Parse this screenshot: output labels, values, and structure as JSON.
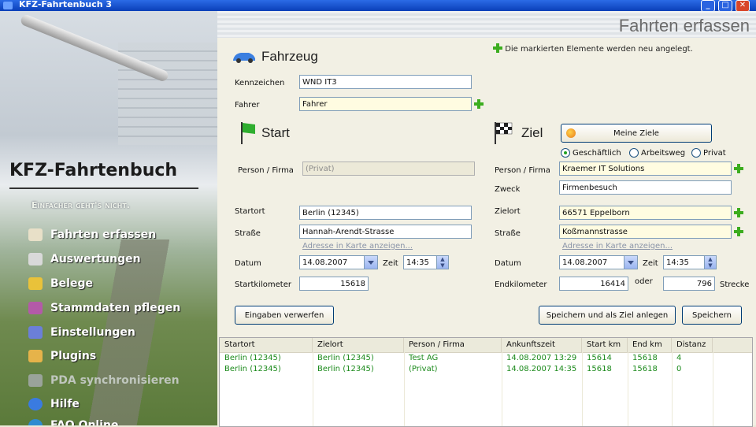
{
  "window": {
    "title": "KFZ-Fahrtenbuch 3"
  },
  "sidebar": {
    "brand": "KFZ-Fahrtenbuch",
    "slogan": "Einfacher geht's nicht.",
    "items": [
      {
        "label": "Fahrten erfassen",
        "icon": "edit-icon",
        "enabled": true
      },
      {
        "label": "Auswertungen",
        "icon": "printer-icon",
        "enabled": true
      },
      {
        "label": "Belege",
        "icon": "receipt-icon",
        "enabled": true
      },
      {
        "label": "Stammdaten pflegen",
        "icon": "database-icon",
        "enabled": true
      },
      {
        "label": "Einstellungen",
        "icon": "checklist-icon",
        "enabled": true
      },
      {
        "label": "Plugins",
        "icon": "plugin-icon",
        "enabled": true
      },
      {
        "label": "PDA synchronisieren",
        "icon": "pda-icon",
        "enabled": false
      },
      {
        "label": "Hilfe",
        "icon": "help-icon",
        "enabled": true
      },
      {
        "label": "FAQ Online",
        "icon": "globe-icon",
        "enabled": true
      }
    ]
  },
  "page": {
    "title": "Fahrten erfassen",
    "hint": "Die markierten Elemente werden neu angelegt."
  },
  "vehicle": {
    "title": "Fahrzeug",
    "plate_label": "Kennzeichen",
    "plate_value": "WND IT3",
    "driver_label": "Fahrer",
    "driver_value": "Fahrer"
  },
  "start": {
    "title": "Start",
    "person_label": "Person / Firma",
    "person_value": "(Privat)",
    "place_label": "Startort",
    "place_value": "Berlin (12345)",
    "street_label": "Straße",
    "street_value": "Hannah-Arendt-Strasse",
    "map_link": "Adresse in Karte anzeigen...",
    "date_label": "Datum",
    "date_value": "14.08.2007",
    "time_label": "Zeit",
    "time_value": "14:35",
    "km_label": "Startkilometer",
    "km_value": "15618"
  },
  "destination": {
    "title": "Ziel",
    "my_goals_button": "Meine Ziele",
    "purpose_options": [
      {
        "label": "Geschäftlich",
        "selected": true
      },
      {
        "label": "Arbeitsweg",
        "selected": false
      },
      {
        "label": "Privat",
        "selected": false
      }
    ],
    "person_label": "Person / Firma",
    "person_value": "Kraemer IT Solutions",
    "reason_label": "Zweck",
    "reason_value": "Firmenbesuch",
    "place_label": "Zielort",
    "place_value": "66571 Eppelborn",
    "street_label": "Straße",
    "street_value": "Koßmannstrasse",
    "map_link": "Adresse in Karte anzeigen...",
    "date_label": "Datum",
    "date_value": "14.08.2007",
    "time_label": "Zeit",
    "time_value": "14:35",
    "km_label": "Endkilometer",
    "km_value": "16414",
    "or_label": "oder",
    "distance_value": "796",
    "distance_label": "Strecke"
  },
  "actions": {
    "discard": "Eingaben verwerfen",
    "save_as_goal": "Speichern und als Ziel anlegen",
    "save": "Speichern"
  },
  "table": {
    "columns": [
      "Startort",
      "Zielort",
      "Person / Firma",
      "Ankunftszeit",
      "Start km",
      "End km",
      "Distanz"
    ],
    "rows": [
      [
        "Berlin (12345)",
        "Berlin (12345)",
        "Test AG",
        "14.08.2007 13:29",
        "15614",
        "15618",
        "4"
      ],
      [
        "Berlin (12345)",
        "Berlin (12345)",
        "(Privat)",
        "14.08.2007 14:35",
        "15618",
        "15618",
        "0"
      ]
    ]
  },
  "colors": {
    "accent_green": "#3cad1f",
    "row_text": "#1b8a1b",
    "title_blue": "#0A3FB8"
  }
}
